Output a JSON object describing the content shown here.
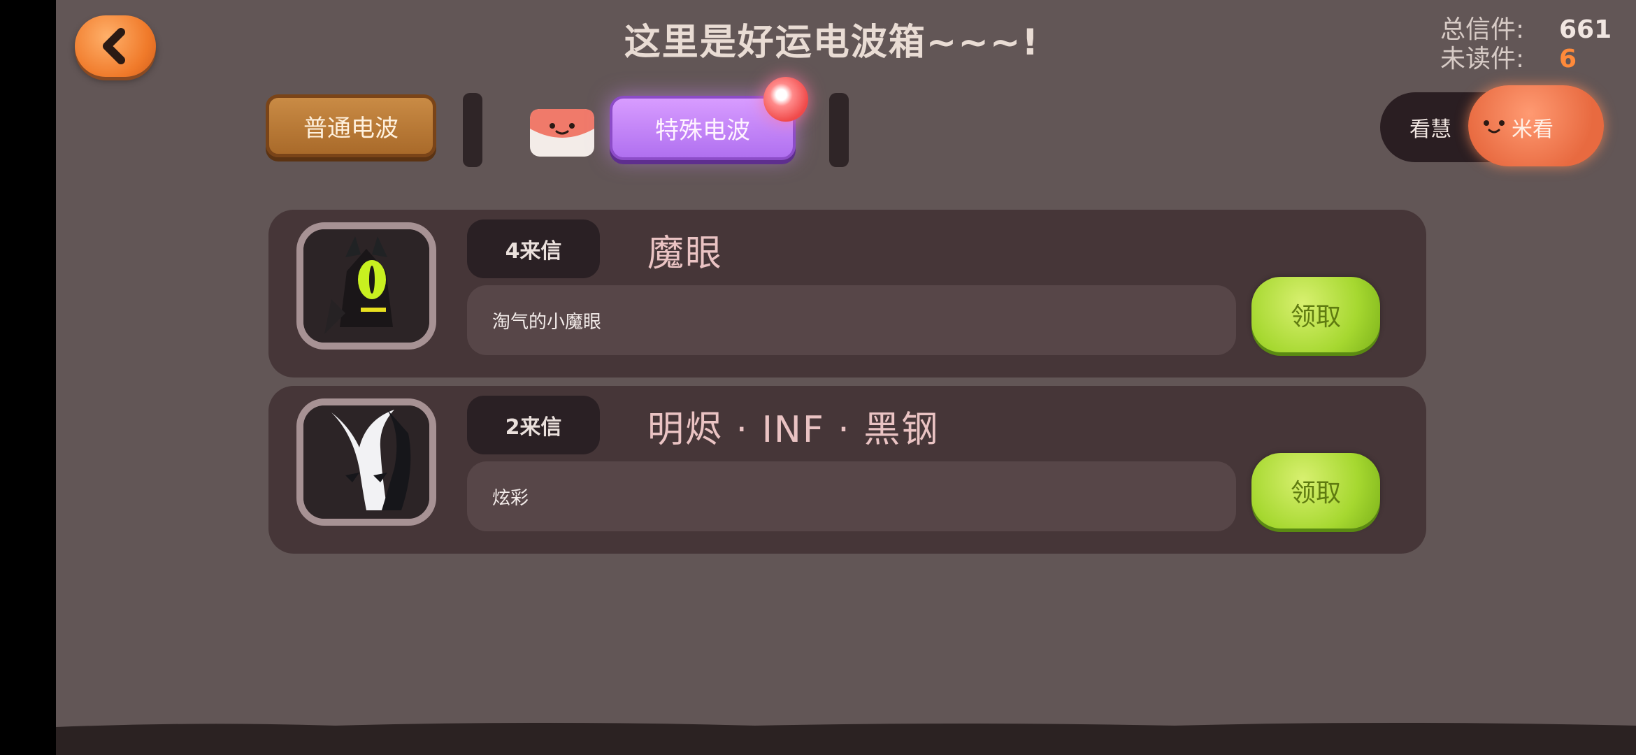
{
  "header": {
    "title": "这里是好运电波箱~~~!",
    "counters": {
      "total_label": "总信件:",
      "total_value": "661",
      "unread_label": "未读件:",
      "unread_value": "6"
    }
  },
  "tabs": {
    "normal": "普通电波",
    "special": "特殊电波",
    "active": "special"
  },
  "toggle": {
    "left_label": "看慧",
    "right_label": "米看"
  },
  "letters": [
    {
      "count_label": "4来信",
      "sender": "魔眼",
      "message": "淘气的小魔眼",
      "claim_label": "领取"
    },
    {
      "count_label": "2来信",
      "sender": "明烬 · INF · 黑钢",
      "message": "炫彩",
      "claim_label": "领取"
    }
  ],
  "colors": {
    "background": "#625656",
    "card": "#463638",
    "accent_orange": "#f07a2a",
    "special_tab": "#b070f0",
    "claim_green": "#a6d830",
    "unread": "#ff8a3a"
  },
  "icons": [
    "back-arrow-icon",
    "mail-face-icon",
    "notification-dot-icon",
    "character-face-icon"
  ]
}
